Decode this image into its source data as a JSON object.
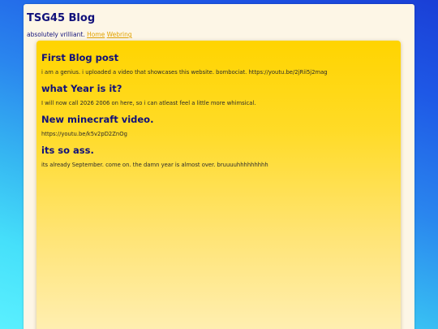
{
  "site": {
    "title": "TSG45 Blog",
    "tagline": "absolutely vrilliant.",
    "nav": [
      {
        "label": "Home"
      },
      {
        "label": "Webring"
      }
    ]
  },
  "posts": [
    {
      "title": "First Blog post",
      "body": "i am a genius. i uploaded a video that showcases this website. bombociat. https://youtu.be/2jRii5j2mag"
    },
    {
      "title": "what Year is it?",
      "body": "I will now call 2026 2006 on here, so i can atleast feel a little more whimsical."
    },
    {
      "title": "New minecraft video.",
      "body": "https://youtu.be/k5v2pD2ZnOg"
    },
    {
      "title": "its so ass.",
      "body": "its already September. come on. the damn year is almost over. bruuuuhhhhhhhhh"
    }
  ],
  "colors": {
    "heading": "#10107a",
    "link": "#e0a100",
    "panel_top": "#ffd400",
    "panel_bottom": "#fff0b8",
    "page_bg": "#fdf6e6"
  }
}
